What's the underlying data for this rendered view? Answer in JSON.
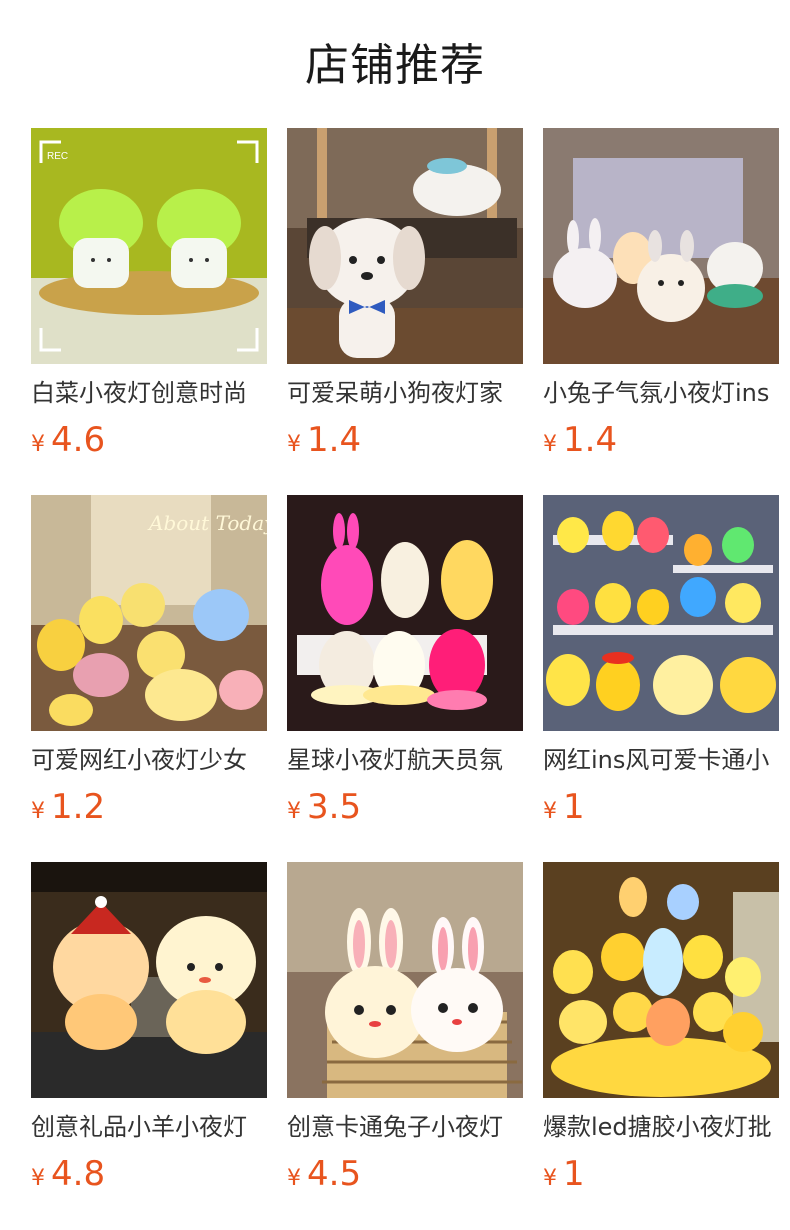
{
  "page_title": "店铺推荐",
  "currency_symbol": "¥",
  "products": [
    {
      "name": "白菜小夜灯创意时尚",
      "price": "4.6",
      "image": "cabbage-lamp-photo"
    },
    {
      "name": "可爱呆萌小狗夜灯家",
      "price": "1.4",
      "image": "puppy-lamp-photo"
    },
    {
      "name": "小兔子气氛小夜灯ins",
      "price": "1.4",
      "image": "bunny-lamp-photo"
    },
    {
      "name": "可爱网红小夜灯少女",
      "price": "1.2",
      "image": "assorted-lamps-photo"
    },
    {
      "name": "星球小夜灯航天员氛",
      "price": "3.5",
      "image": "astronaut-lamp-photo"
    },
    {
      "name": "网红ins风可爱卡通小",
      "price": "1",
      "image": "cartoon-lamps-shelf-photo"
    },
    {
      "name": "创意礼品小羊小夜灯",
      "price": "4.8",
      "image": "sheep-lamp-photo"
    },
    {
      "name": "创意卡通兔子小夜灯",
      "price": "4.5",
      "image": "rabbit-lamp-photo"
    },
    {
      "name": "爆款led搪胶小夜灯批",
      "price": "1",
      "image": "yellow-lamps-photo"
    }
  ],
  "photo_overlay_text": {
    "rec_label": "REC",
    "about_today": "About Today"
  }
}
